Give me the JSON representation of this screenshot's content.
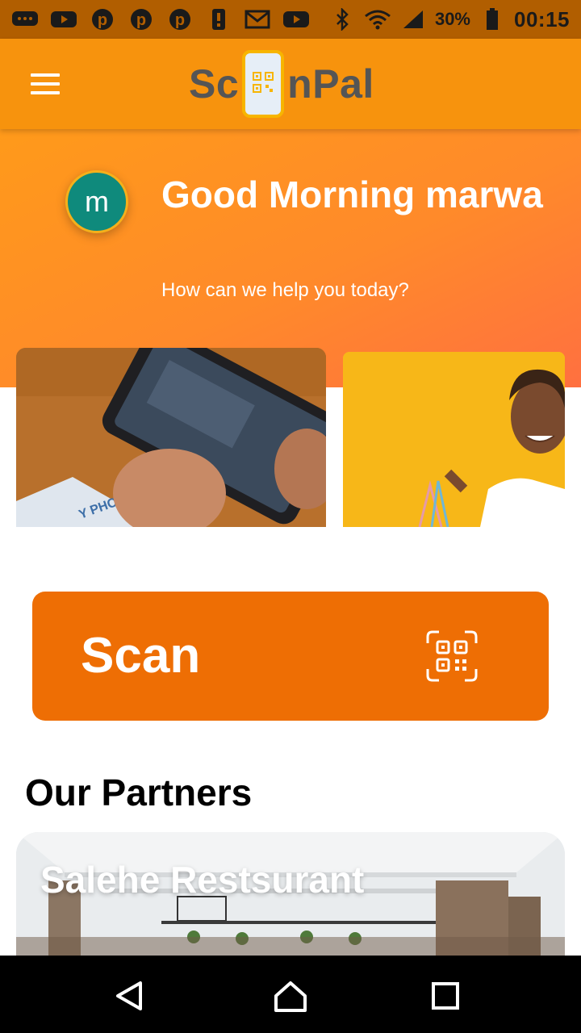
{
  "status_bar": {
    "left_icons": [
      "chat-icon",
      "youtube-icon",
      "pinterest-icon",
      "pinterest-icon",
      "pinterest-icon",
      "alert-icon",
      "gmail-icon",
      "youtube-icon"
    ],
    "battery": "30%",
    "time": "00:15"
  },
  "app_bar": {
    "logo_left": "Sc",
    "logo_right": "nPal"
  },
  "greeting": {
    "title": "Good Morning marwa",
    "subtitle": "How can we help you today?",
    "avatar_initial": "m"
  },
  "scan": {
    "label": "Scan"
  },
  "partners": {
    "title": "Our Partners",
    "items": [
      {
        "name": "Salehe Restsurant"
      }
    ]
  },
  "colors": {
    "status_bar": "#b15e00",
    "app_bar": "#f7930d",
    "scan_button": "#ee6e04",
    "avatar": "#0f8a7c"
  }
}
